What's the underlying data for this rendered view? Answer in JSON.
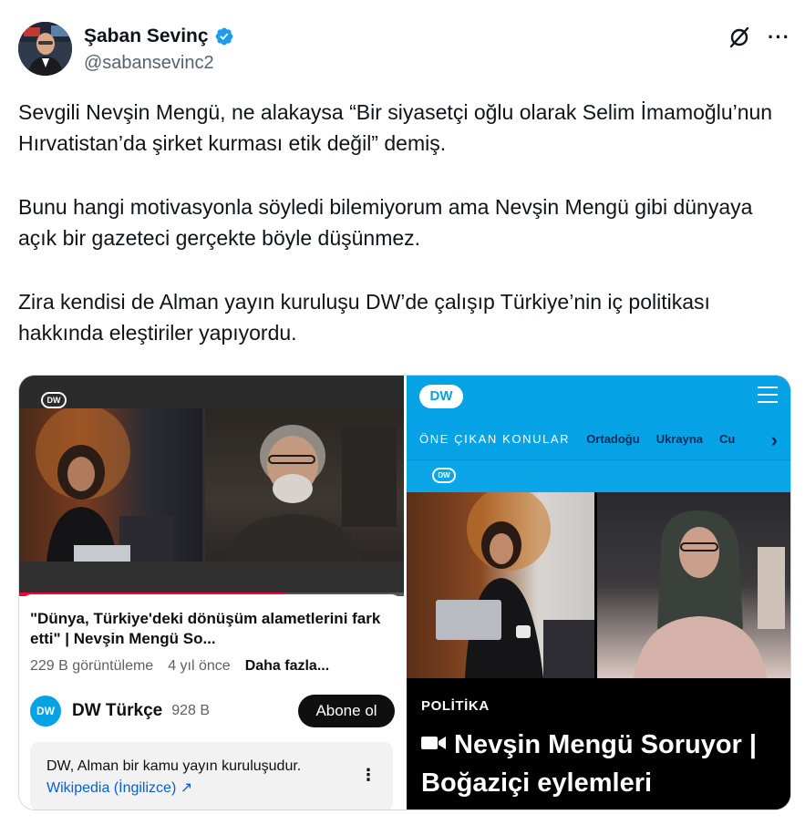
{
  "author": {
    "display_name": "Şaban Sevinç",
    "handle": "@sabansevinc2",
    "verified": true
  },
  "actions": {
    "grok_icon": "grok-icon",
    "more_icon": "more-icon",
    "more_glyph": "···"
  },
  "tweet": {
    "paragraphs": [
      "Sevgili Nevşin Mengü, ne alakaysa “Bir siyasetçi oğlu olarak Selim İmamoğlu’nun Hırvatistan’da şirket kurması etik değil” demiş.",
      "Bunu hangi motivasyonla söyledi bilemiyorum ama Nevşin Mengü gibi dünyaya açık bir gazeteci gerçekte böyle düşünmez.",
      "Zira kendisi de Alman yayın kuruluşu DW’de çalışıp Türkiye’nin iç politikası hakkında eleştiriler yapıyordu."
    ]
  },
  "media_left": {
    "video_logo": "DW",
    "progress": 0.69,
    "title": "\"Dünya, Türkiye'deki dönüşüm alametlerini fark etti\" | Nevşin Mengü So...",
    "views": "229 B görüntüleme",
    "age": "4 yıl önce",
    "more": "Daha fazla...",
    "channel": {
      "logo": "DW",
      "name": "DW Türkçe",
      "subscribers": "928 B",
      "subscribe_label": "Abone ol"
    },
    "info": {
      "text": "DW, Alman bir kamu yayın kuruluşudur.",
      "link": "Wikipedia (İngilizce) ↗",
      "dots": "⋮"
    }
  },
  "media_right": {
    "logo": "DW",
    "topics_label": "ÖNE ÇIKAN KONULAR",
    "topics": [
      "Ortadoğu",
      "Ukrayna",
      "Cu"
    ],
    "chevron": "›",
    "strip_logo": "DW",
    "kicker": "POLİTİKA",
    "title": "Nevşin Mengü Soruyor | Boğaziçi eylemleri"
  },
  "colors": {
    "dw_blue": "#05a2e6",
    "dw_navy": "#002d5a",
    "verified_blue": "#1d9bf0",
    "yt_red": "#ff0033"
  }
}
